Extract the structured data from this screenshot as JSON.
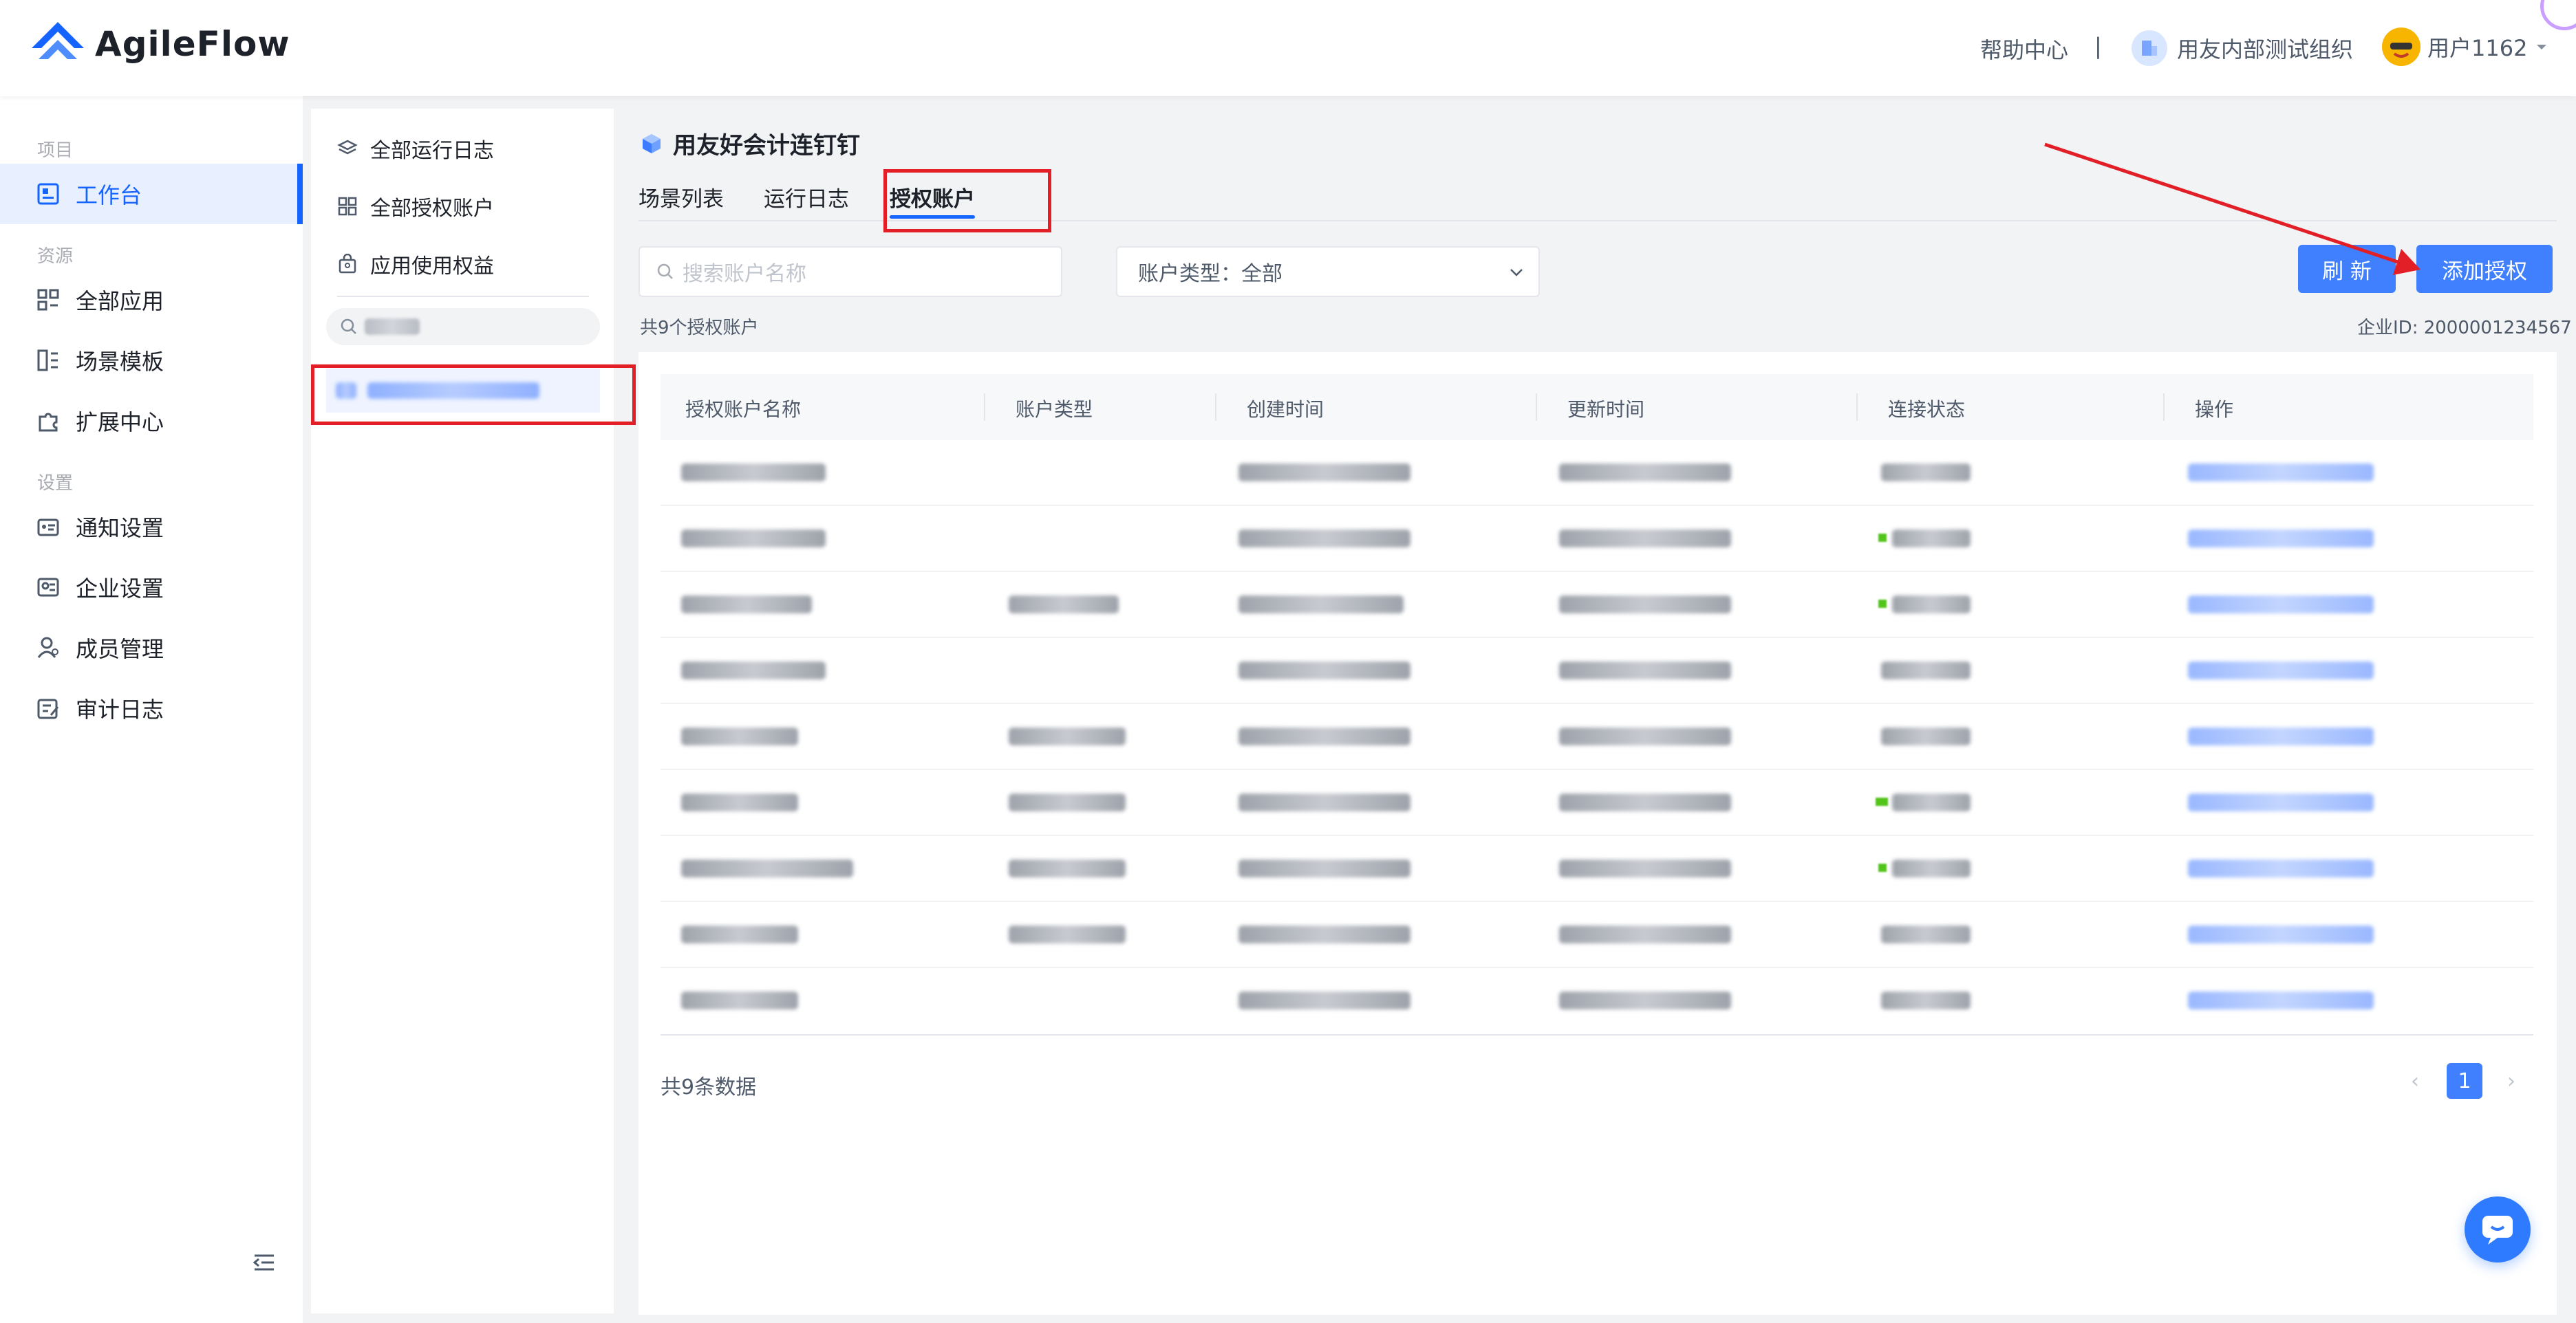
{
  "app": {
    "name": "AgileFlow"
  },
  "topbar": {
    "help": "帮助中心",
    "separator": "|",
    "org": "用友内部测试组织",
    "user": "用户1162"
  },
  "sidebar": {
    "groups": {
      "project": "项目",
      "resource": "资源",
      "settings": "设置"
    },
    "items": [
      {
        "label": "工作台",
        "icon": "dashboard-icon",
        "active": true
      },
      {
        "label": "全部应用",
        "icon": "apps-grid-icon"
      },
      {
        "label": "场景模板",
        "icon": "template-icon"
      },
      {
        "label": "扩展中心",
        "icon": "puzzle-icon"
      },
      {
        "label": "通知设置",
        "icon": "notification-icon"
      },
      {
        "label": "企业设置",
        "icon": "enterprise-icon"
      },
      {
        "label": "成员管理",
        "icon": "members-icon"
      },
      {
        "label": "审计日志",
        "icon": "audit-log-icon"
      }
    ]
  },
  "panel2": {
    "items": [
      {
        "label": "全部运行日志",
        "icon": "layers-icon"
      },
      {
        "label": "全部授权账户",
        "icon": "grid-icon"
      },
      {
        "label": "应用使用权益",
        "icon": "bag-icon"
      }
    ]
  },
  "main": {
    "title": "用友好会计连钉钉",
    "tabs": [
      {
        "label": "场景列表"
      },
      {
        "label": "运行日志"
      },
      {
        "label": "授权账户",
        "active": true
      }
    ],
    "search_placeholder": "搜索账户名称",
    "account_type_label": "账户类型：全部",
    "refresh_label": "刷 新",
    "add_label": "添加授权",
    "count_text": "共9个授权账户",
    "corp_id": "企业ID: 2000001234567",
    "columns": [
      "授权账户名称",
      "账户类型",
      "创建时间",
      "更新时间",
      "连接状态",
      "操作"
    ],
    "total_text": "共9条数据",
    "page": "1",
    "prev": "‹",
    "next": "›"
  },
  "colors": {
    "accent": "#1664ff",
    "button": "#4080ff",
    "annotation": "#e21f26"
  }
}
